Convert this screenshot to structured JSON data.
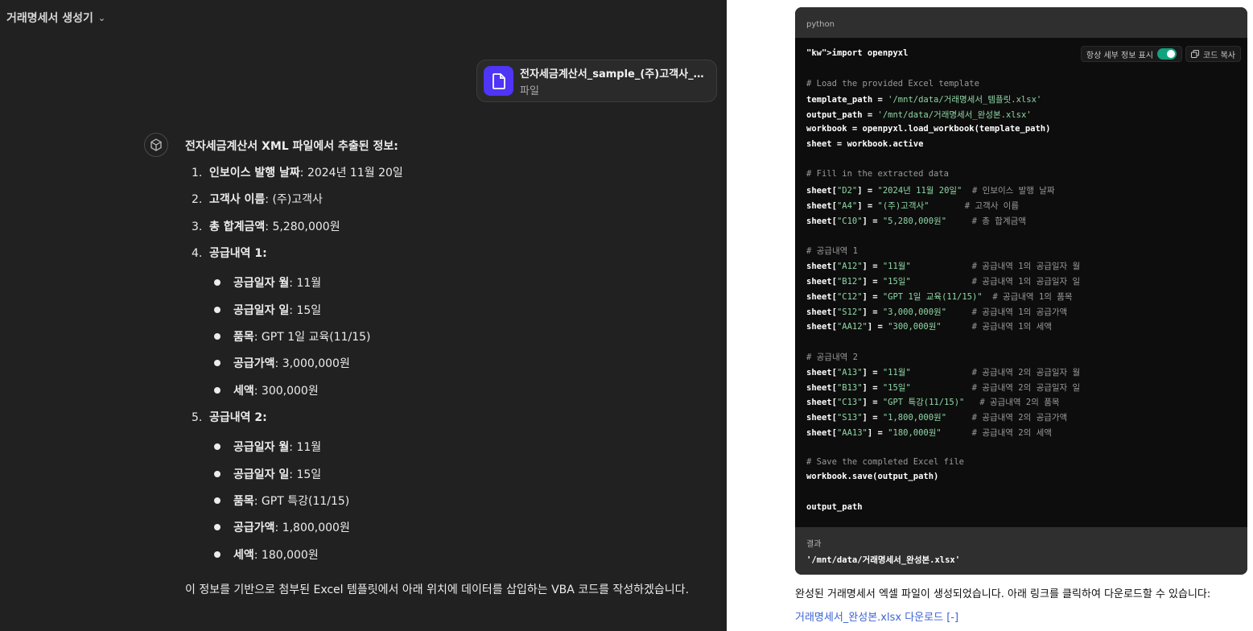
{
  "chat": {
    "title": "거래명세서 생성기",
    "file": {
      "name": "전자세금계산서_sample_(주)고객사_2...",
      "type": "파일"
    },
    "heading": "전자세금계산서 XML 파일에서 추출된 정보:",
    "items": [
      {
        "num": "1.",
        "label": "인보이스 발행 날짜",
        "value": ": 2024년 11월 20일"
      },
      {
        "num": "2.",
        "label": "고객사 이름",
        "value": ": (주)고객사"
      },
      {
        "num": "3.",
        "label": "총 합계금액",
        "value": ": 5,280,000원"
      },
      {
        "num": "4.",
        "label": "공급내역 1",
        "value": ":"
      },
      {
        "num": "5.",
        "label": "공급내역 2",
        "value": ":"
      }
    ],
    "supply1": [
      {
        "label": "공급일자 월",
        "value": ": 11월"
      },
      {
        "label": "공급일자 일",
        "value": ": 15일"
      },
      {
        "label": "품목",
        "value": ": GPT 1일 교육(11/15)"
      },
      {
        "label": "공급가액",
        "value": ": 3,000,000원"
      },
      {
        "label": "세액",
        "value": ": 300,000원"
      }
    ],
    "supply2": [
      {
        "label": "공급일자 월",
        "value": ": 11월"
      },
      {
        "label": "공급일자 일",
        "value": ": 15일"
      },
      {
        "label": "품목",
        "value": ": GPT 특강(11/15)"
      },
      {
        "label": "공급가액",
        "value": ": 1,800,000원"
      },
      {
        "label": "세액",
        "value": ": 180,000원"
      }
    ],
    "paragraph": "이 정보를 기반으로 첨부된 Excel 템플릿에서 아래 위치에 데이터를 삽입하는 VBA 코드를 작성하겠습니다."
  },
  "analysis": {
    "language": "python",
    "toggle_label": "항상 세부 정보 표시",
    "copy_label": "코드 복사",
    "code_lines": [
      "import openpyxl",
      "",
      "# Load the provided Excel template",
      "template_path = '/mnt/data/거래명세서_템플릿.xlsx'",
      "output_path = '/mnt/data/거래명세서_완성본.xlsx'",
      "workbook = openpyxl.load_workbook(template_path)",
      "sheet = workbook.active",
      "",
      "# Fill in the extracted data",
      "sheet[\"D2\"] = \"2024년 11월 20일\"  # 인보이스 발행 날짜",
      "sheet[\"A4\"] = \"(주)고객사\"       # 고객사 이름",
      "sheet[\"C10\"] = \"5,280,000원\"     # 총 합계금액",
      "",
      "# 공급내역 1",
      "sheet[\"A12\"] = \"11월\"            # 공급내역 1의 공급일자 월",
      "sheet[\"B12\"] = \"15일\"            # 공급내역 1의 공급일자 일",
      "sheet[\"C12\"] = \"GPT 1일 교육(11/15)\"  # 공급내역 1의 품목",
      "sheet[\"S12\"] = \"3,000,000원\"     # 공급내역 1의 공급가액",
      "sheet[\"AA12\"] = \"300,000원\"      # 공급내역 1의 세액",
      "",
      "# 공급내역 2",
      "sheet[\"A13\"] = \"11월\"            # 공급내역 2의 공급일자 월",
      "sheet[\"B13\"] = \"15일\"            # 공급내역 2의 공급일자 일",
      "sheet[\"C13\"] = \"GPT 특강(11/15)\"   # 공급내역 2의 품목",
      "sheet[\"S13\"] = \"1,800,000원\"     # 공급내역 2의 공급가액",
      "sheet[\"AA13\"] = \"180,000원\"      # 공급내역 2의 세액",
      "",
      "# Save the completed Excel file",
      "workbook.save(output_path)",
      "",
      "output_path"
    ],
    "result_label": "결과",
    "result_value": "'/mnt/data/거래명세서_완성본.xlsx'",
    "done_text": "완성된 거래명세서 엑셀 파일이 생성되었습니다. 아래 링크를 클릭하여 다운로드할 수 있습니다:",
    "download_link": "거래명세서_완성본.xlsx 다운로드 [-]"
  }
}
